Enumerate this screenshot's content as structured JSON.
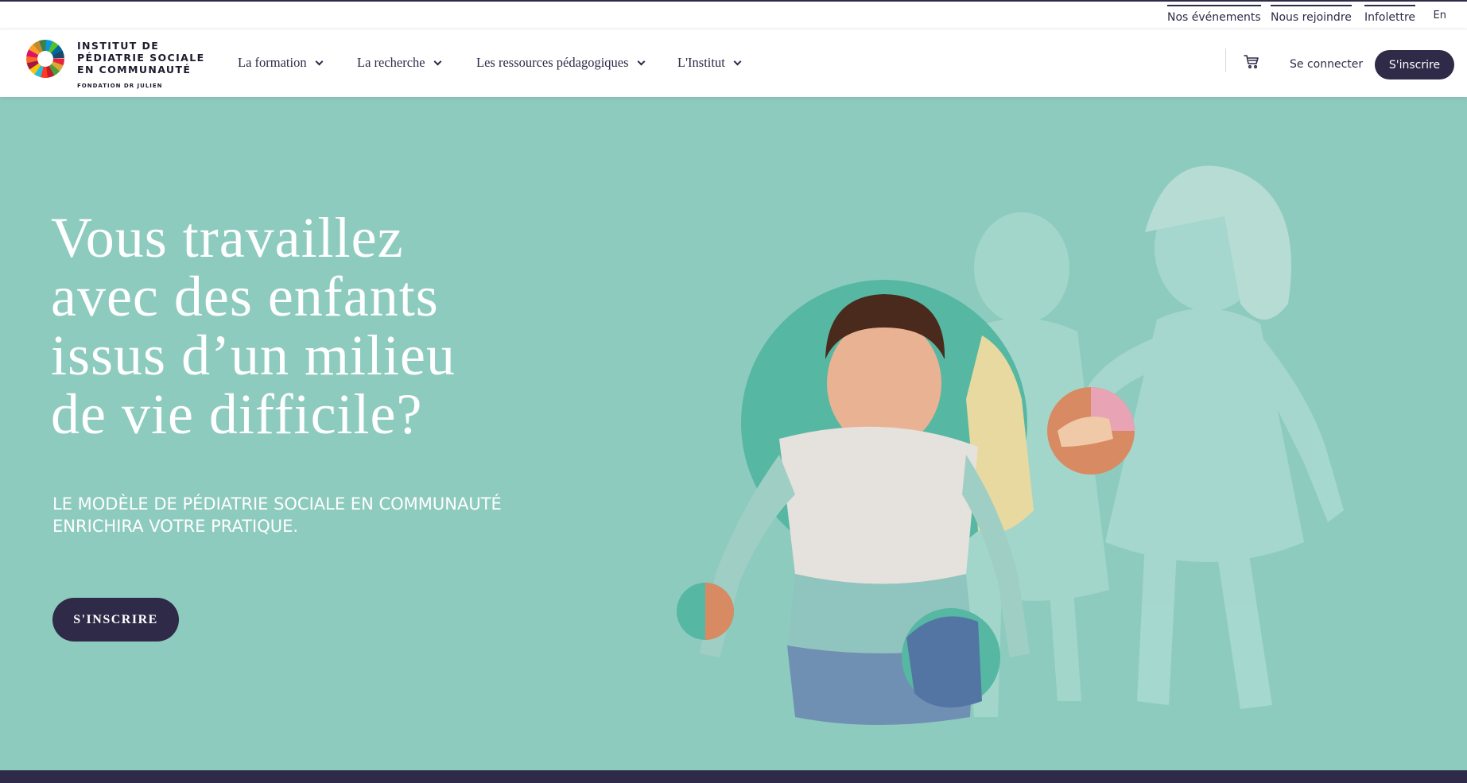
{
  "topbar": {
    "links": [
      "Nos événements",
      "Nous rejoindre",
      "Infolettre"
    ],
    "language": "En"
  },
  "brand": {
    "line1": "INSTITUT DE",
    "line2": "PÉDIATRIE SOCIALE",
    "line3": "EN COMMUNAUTÉ",
    "sub": "FONDATION DR JULIEN",
    "logo_icon": "colorful-ring-logo"
  },
  "nav": {
    "items": [
      "La formation",
      "La recherche",
      "Les ressources pédagogiques",
      "L'Institut"
    ]
  },
  "header_actions": {
    "cart_icon": "cart-icon",
    "login": "Se connecter",
    "signup": "S'inscrire"
  },
  "hero": {
    "title_lines": [
      "Vous travaillez",
      "avec des enfants",
      "issus d’un milieu",
      "de vie difficile?"
    ],
    "subtitle_line1": "LE MODÈLE DE PÉDIATRIE SOCIALE EN COMMUNAUTÉ",
    "subtitle_line2": "ENRICHIRA VOTRE PRATIQUE.",
    "cta": "S'INSCRIRE",
    "background_color": "#8ecbbf",
    "accent_color": "#2e2a47"
  }
}
